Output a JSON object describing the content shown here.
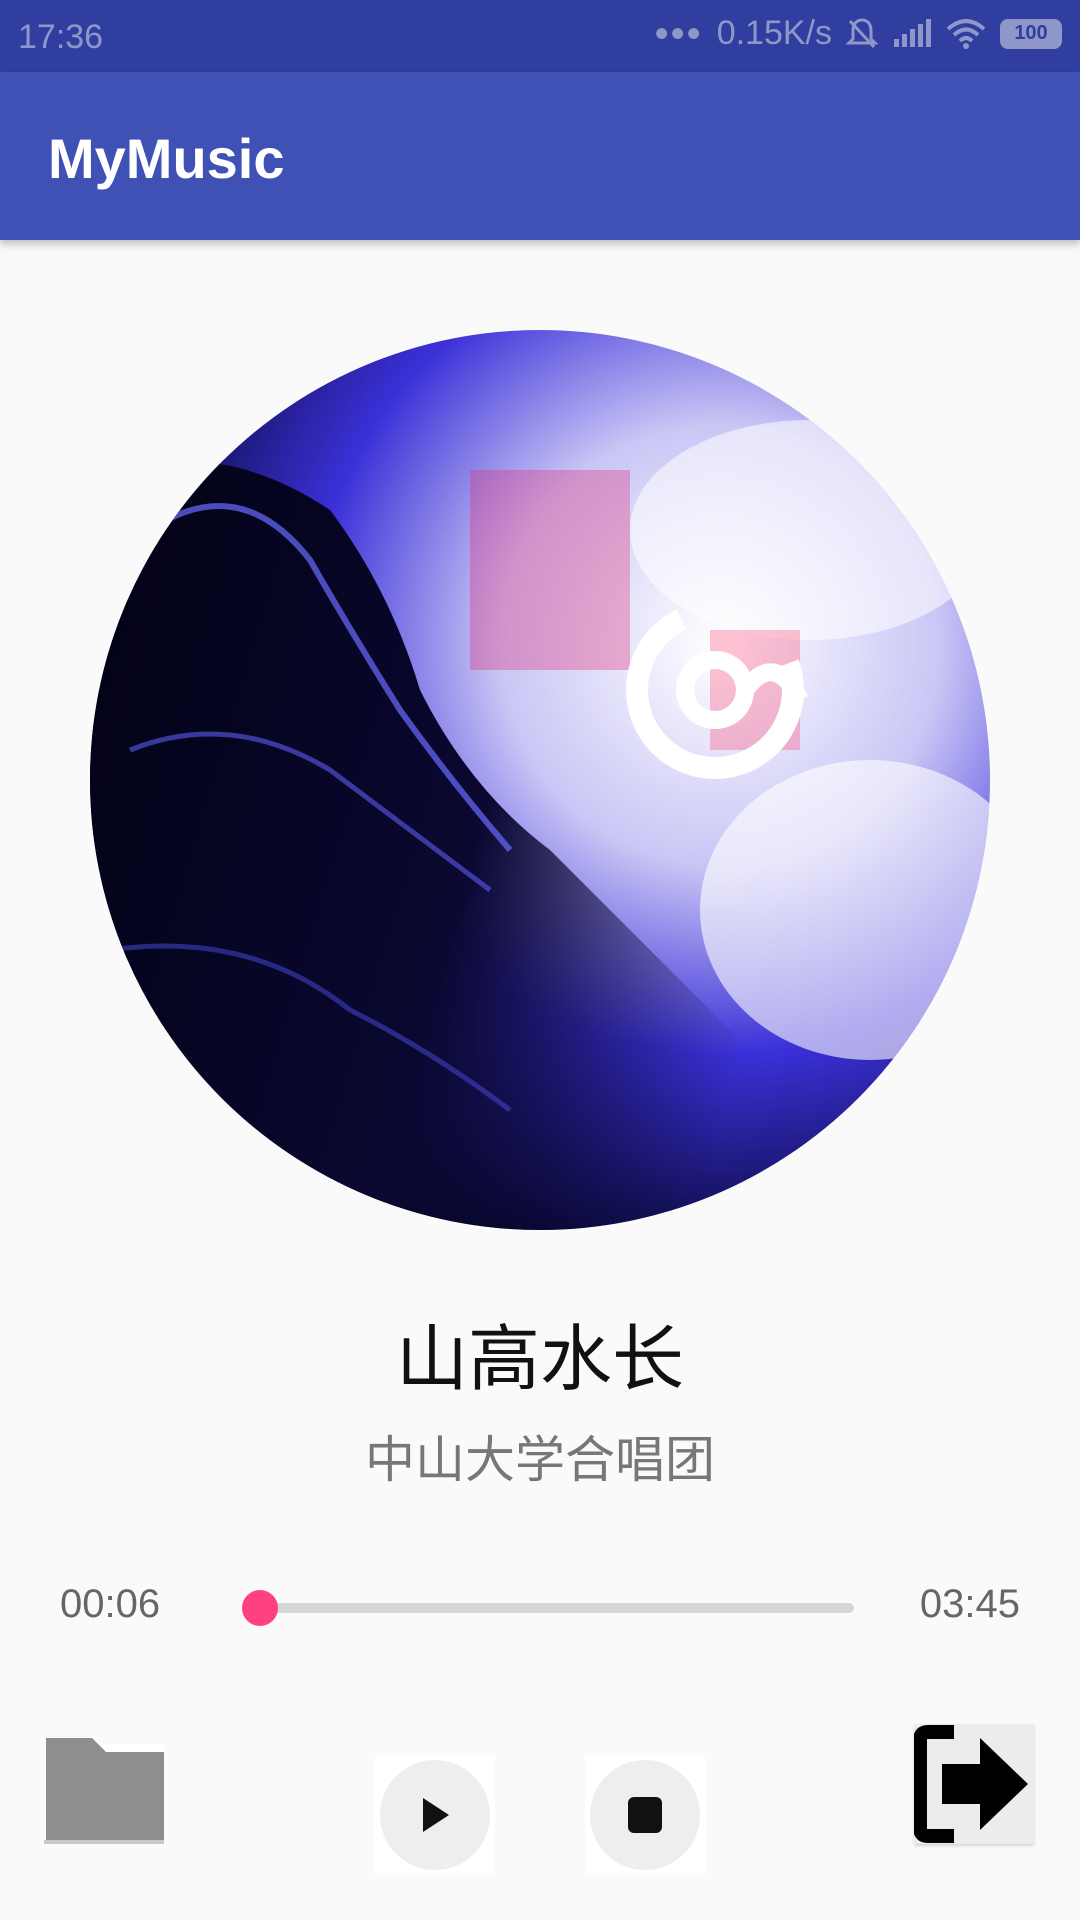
{
  "status_bar": {
    "time": "17:36",
    "speed": "0.15K/s",
    "battery": "100"
  },
  "app_bar": {
    "title": "MyMusic"
  },
  "album_art": {
    "description_icon": "album-logo-icon"
  },
  "song": {
    "title": "山高水长",
    "artist": "中山大学合唱团"
  },
  "playback": {
    "current_time": "00:06",
    "total_time": "03:45",
    "progress_fraction": 0.027
  },
  "controls": {
    "folder_icon": "folder-icon",
    "play_icon": "play-icon",
    "stop_icon": "stop-icon",
    "exit_icon": "exit-icon"
  },
  "colors": {
    "status_bar": "#303f9f",
    "app_bar": "#3f51b5",
    "accent": "#ff4081",
    "background": "#fafafa"
  }
}
